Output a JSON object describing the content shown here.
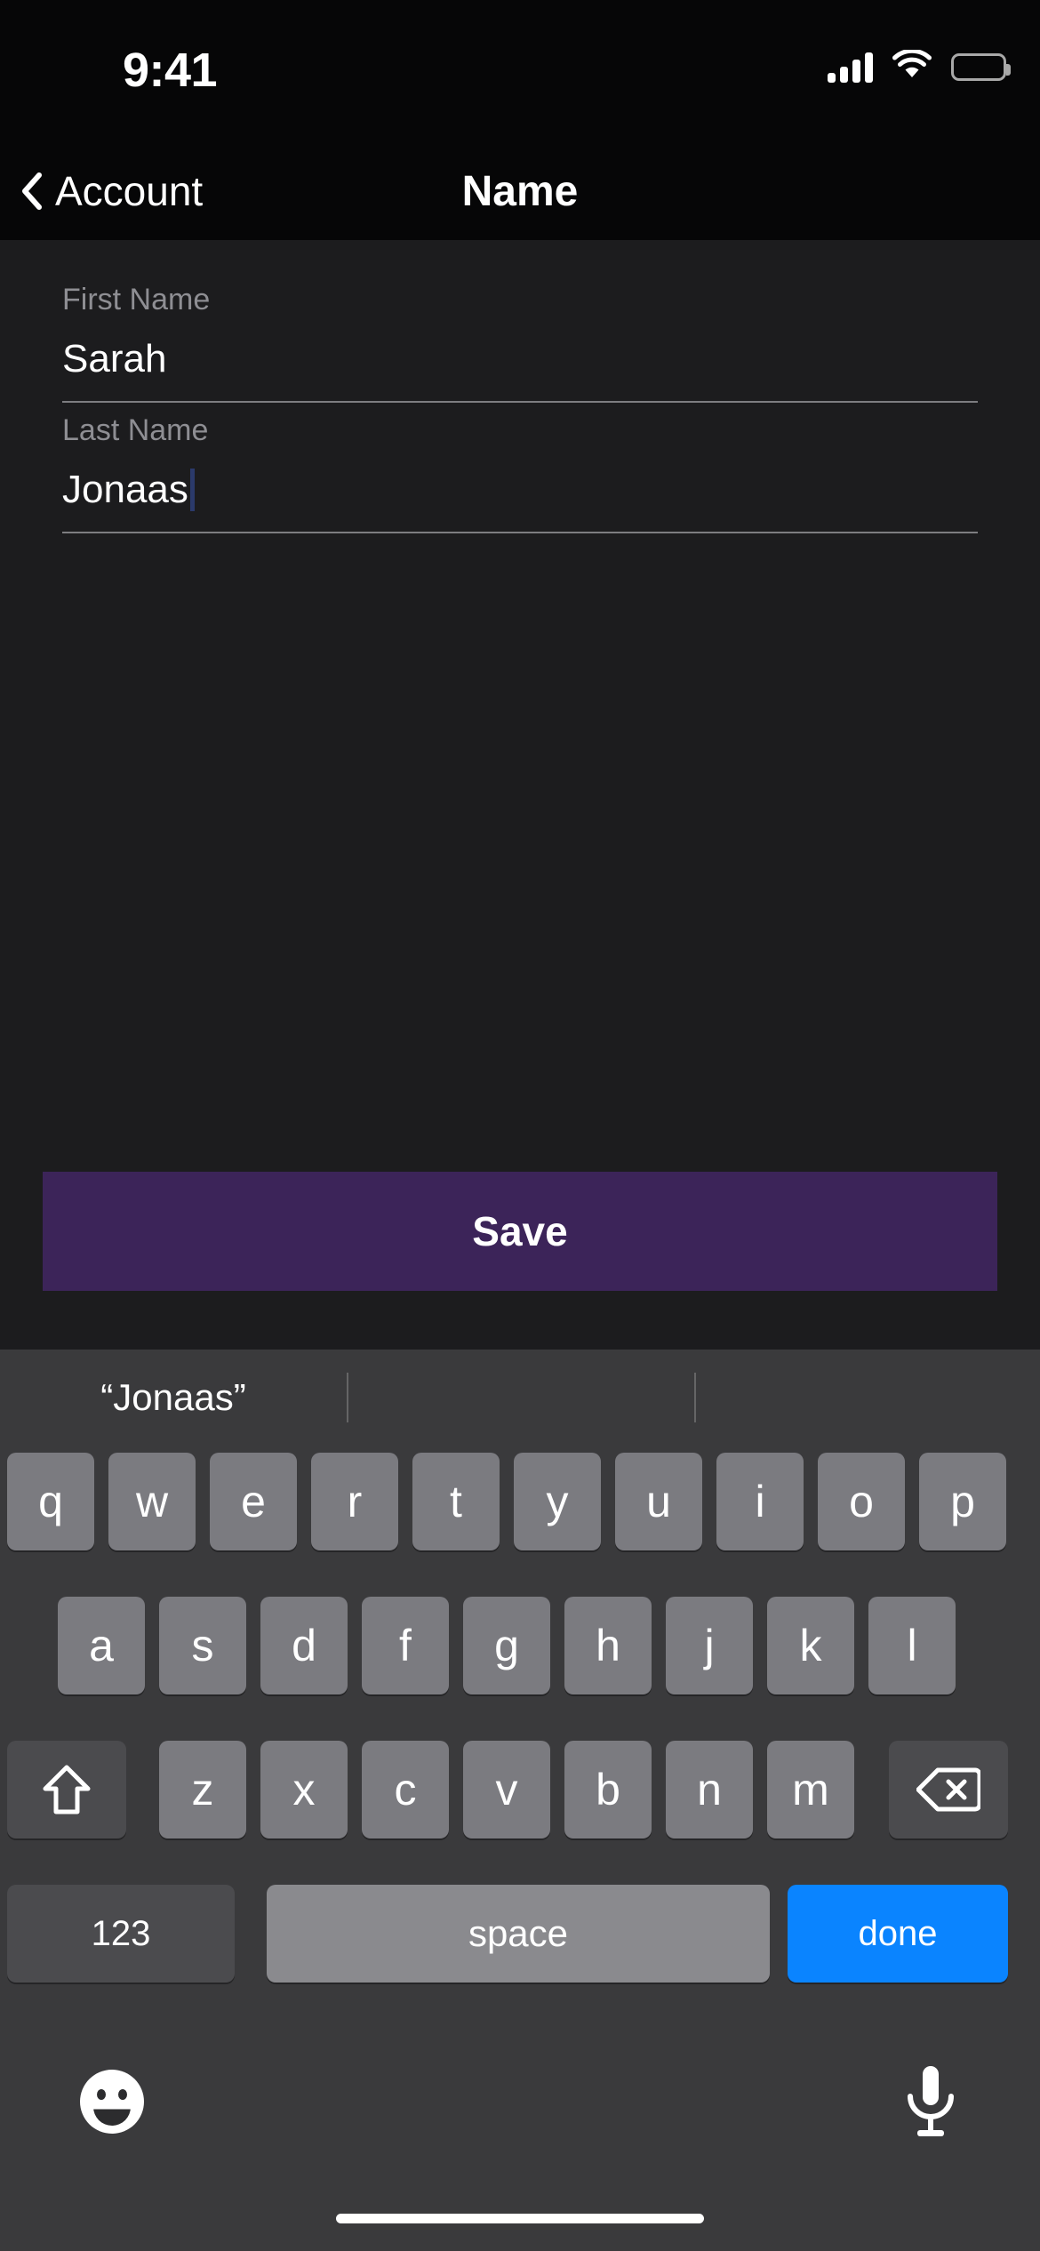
{
  "status_bar": {
    "time": "9:41",
    "cellular_icon": "cellular-signal-icon",
    "wifi_icon": "wifi-icon",
    "battery_icon": "battery-full-icon"
  },
  "nav_bar": {
    "back_icon": "chevron-left-icon",
    "back_label": "Account",
    "title": "Name"
  },
  "form": {
    "fields": [
      {
        "label": "First Name",
        "value": "Sarah",
        "focused": false
      },
      {
        "label": "Last Name",
        "value": "Jonaas",
        "focused": true
      }
    ],
    "loading_indicator": "loading-dot",
    "save_label": "Save",
    "save_color": "#3c2459"
  },
  "keyboard": {
    "suggestions": [
      "“Jonaas”",
      "",
      ""
    ],
    "rows": [
      [
        {
          "label": "q"
        },
        {
          "label": "w"
        },
        {
          "label": "e"
        },
        {
          "label": "r"
        },
        {
          "label": "t"
        },
        {
          "label": "y"
        },
        {
          "label": "u"
        },
        {
          "label": "i"
        },
        {
          "label": "o"
        },
        {
          "label": "p"
        }
      ],
      [
        {
          "label": "a"
        },
        {
          "label": "s"
        },
        {
          "label": "d"
        },
        {
          "label": "f"
        },
        {
          "label": "g"
        },
        {
          "label": "h"
        },
        {
          "label": "j"
        },
        {
          "label": "k"
        },
        {
          "label": "l"
        }
      ],
      [
        {
          "label": "",
          "icon": "shift-up-arrow-icon"
        },
        {
          "label": "z"
        },
        {
          "label": "x"
        },
        {
          "label": "c"
        },
        {
          "label": "v"
        },
        {
          "label": "b"
        },
        {
          "label": "n"
        },
        {
          "label": "m"
        },
        {
          "label": "",
          "icon": "backspace-delete-icon"
        }
      ],
      [
        {
          "label": "123"
        },
        {
          "label": "space"
        },
        {
          "label": "done"
        }
      ]
    ],
    "emoji_icon": "emoji-smiley-icon",
    "mic_icon": "microphone-icon",
    "done_key_color": "#0a84ff",
    "key_color": "#7b7b80",
    "special_key_color": "#4b4b4e",
    "background_color": "#3a3a3c"
  },
  "home_indicator": "home-indicator-bar"
}
